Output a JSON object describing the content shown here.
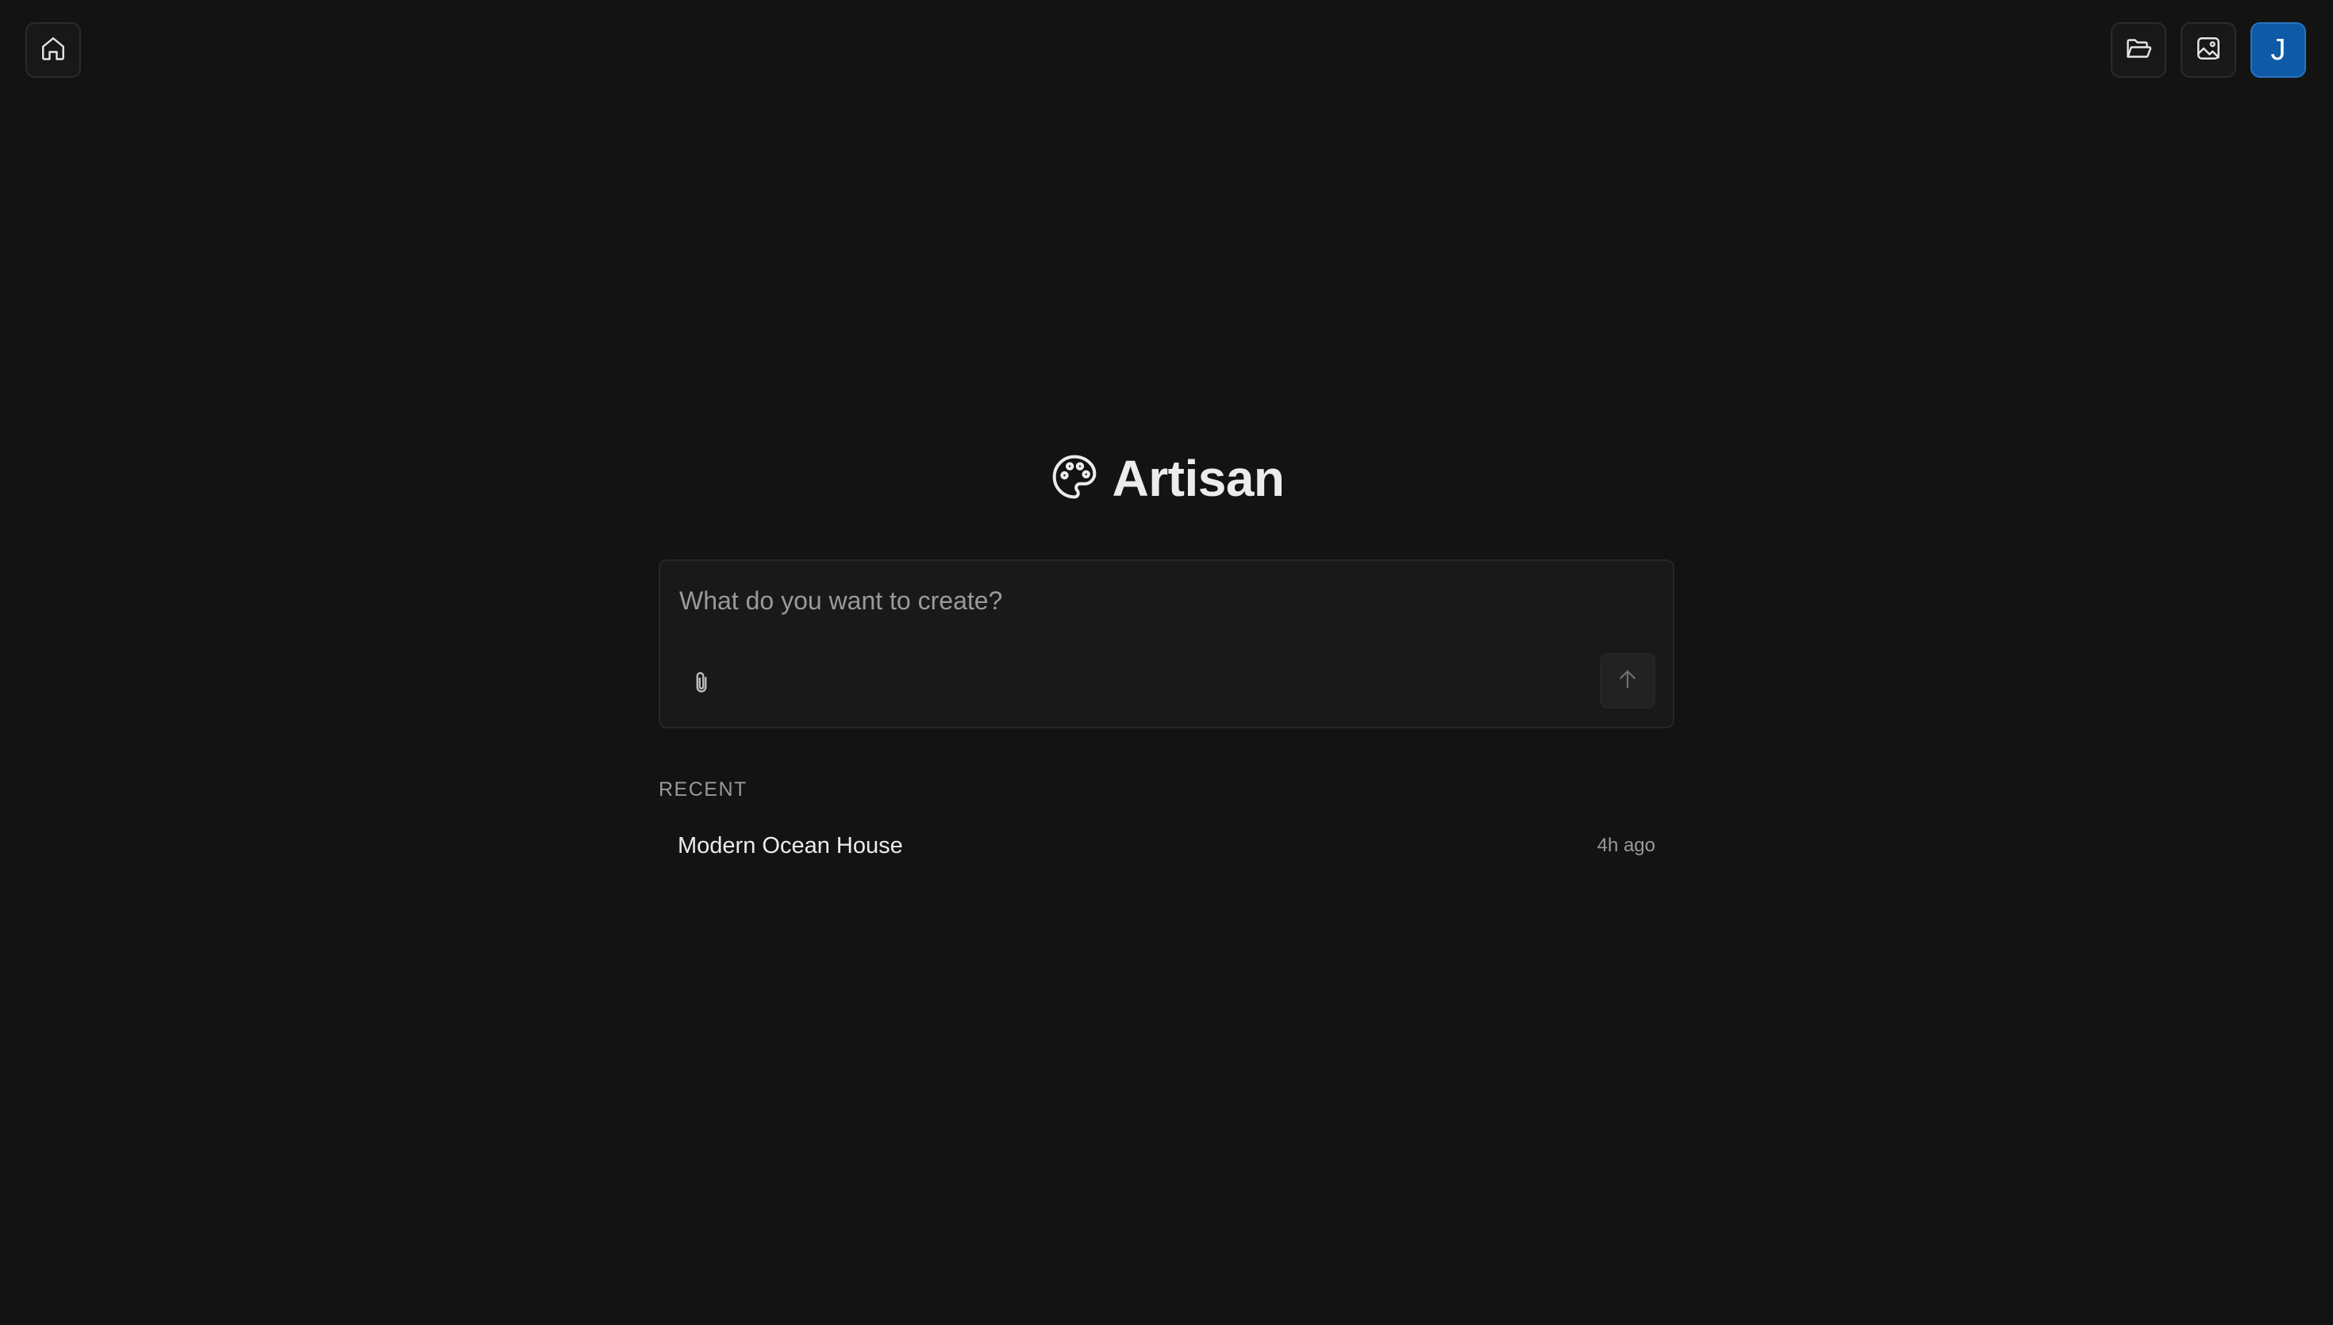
{
  "app": {
    "title": "Artisan",
    "brand_icon": "palette-icon"
  },
  "topbar": {
    "home_icon": "home-icon",
    "projects_icon": "folder-open-icon",
    "gallery_icon": "image-icon",
    "avatar_initial": "J",
    "avatar_color": "#0e5aa7"
  },
  "composer": {
    "placeholder": "What do you want to create?",
    "value": "",
    "attach_icon": "paperclip-icon",
    "send_icon": "arrow-up-icon"
  },
  "recent": {
    "heading": "RECENT",
    "items": [
      {
        "title": "Modern Ocean House",
        "time": "4h ago"
      }
    ]
  },
  "colors": {
    "background": "#131313",
    "panel": "#191919",
    "border": "#262626",
    "text": "#ececec",
    "muted": "#9a9a9a"
  }
}
